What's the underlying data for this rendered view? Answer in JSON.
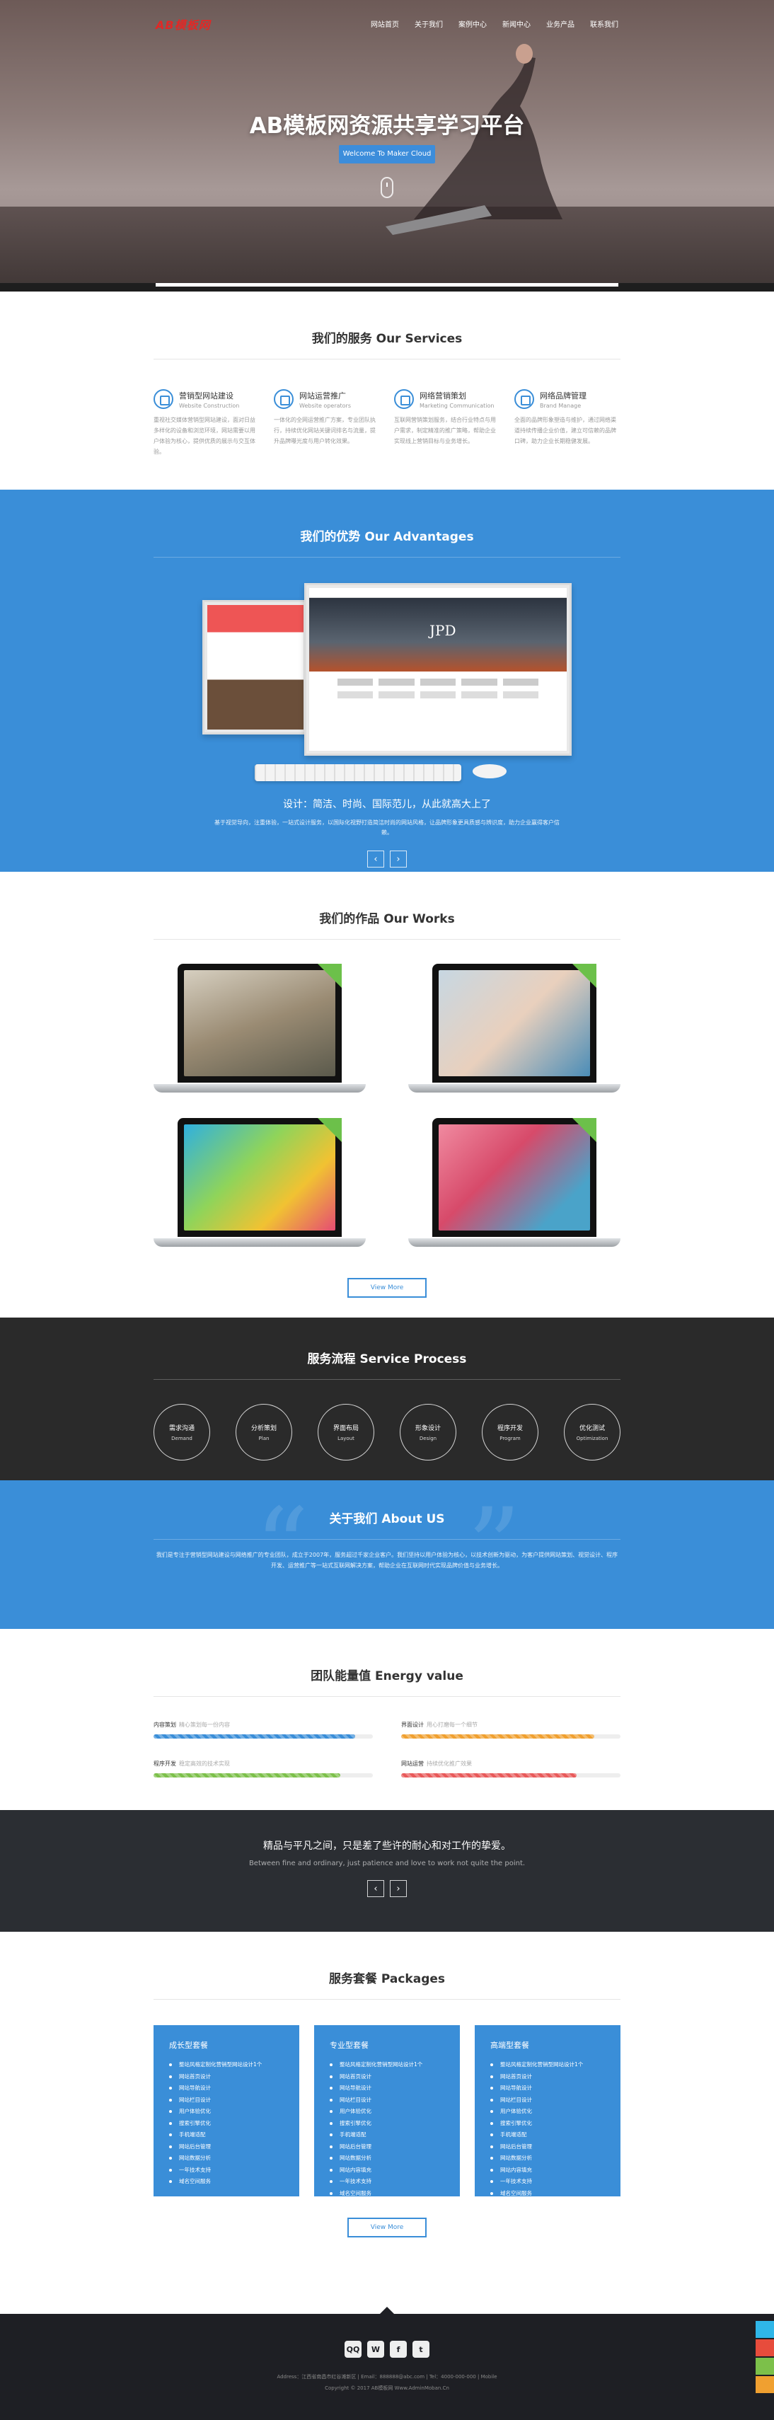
{
  "header": {
    "logo": "AB模板网",
    "nav": [
      "网站首页",
      "关于我们",
      "案例中心",
      "新闻中心",
      "业务产品",
      "联系我们"
    ]
  },
  "hero": {
    "title": "AB模板网资源共享学习平台",
    "button": "Welcome To Maker Cloud"
  },
  "services": {
    "title": "我们的服务 Our Services",
    "items": [
      {
        "icon": "gear-icon",
        "title": "营销型网站建设",
        "subtitle": "Website Construction",
        "desc": "重视社交媒体营销型网站建设，面对日益多样化的设备和浏览环境，网站需要以用户体验为核心，提供优质的展示与交互体验。"
      },
      {
        "icon": "chart-icon",
        "title": "网站运营推广",
        "subtitle": "Website operators",
        "desc": "一体化的全网运营推广方案，专业团队执行，持续优化网站关键词排名与流量，提升品牌曝光度与用户转化效果。"
      },
      {
        "icon": "compass-icon",
        "title": "网络营销策划",
        "subtitle": "Marketing Communication",
        "desc": "互联网营销策划服务，结合行业特点与用户需求，制定精准的推广策略，帮助企业实现线上营销目标与业务增长。"
      },
      {
        "icon": "refresh-icon",
        "title": "网络品牌管理",
        "subtitle": "Brand Manage",
        "desc": "全面的品牌形象塑造与维护，通过网络渠道持续传播企业价值，建立可信赖的品牌口碑，助力企业长期稳健发展。"
      }
    ]
  },
  "advantages": {
    "title": "我们的优势 Our Advantages",
    "heading": "设计：简洁、时尚、国际范儿，从此就高大上了",
    "desc": "基于视觉导向，注重体验，一站式设计服务，以国际化视野打造简洁时尚的网站风格，让品牌形象更具质感与辨识度，助力企业赢得客户信赖。",
    "screen_brand": "JPD"
  },
  "works": {
    "title": "我们的作品 Our Works",
    "more": "View More",
    "items": [
      {
        "name": "work-ring-dancers"
      },
      {
        "name": "work-dental"
      },
      {
        "name": "work-colorful-app"
      },
      {
        "name": "work-fitness"
      }
    ]
  },
  "process": {
    "title": "服务流程 Service Process",
    "steps": [
      {
        "cn": "需求沟通",
        "en": "Demand"
      },
      {
        "cn": "分析策划",
        "en": "Plan"
      },
      {
        "cn": "界面布局",
        "en": "Layout"
      },
      {
        "cn": "形象设计",
        "en": "Design"
      },
      {
        "cn": "程序开发",
        "en": "Program"
      },
      {
        "cn": "优化测试",
        "en": "Optimization"
      }
    ]
  },
  "about": {
    "title": "关于我们 About US",
    "text": "我们是专注于营销型网站建设与网络推广的专业团队，成立于2007年，服务超过千家企业客户。我们坚持以用户体验为核心，以技术创新为驱动，为客户提供网站策划、视觉设计、程序开发、运营推广等一站式互联网解决方案，帮助企业在互联网时代实现品牌价值与业务增长。"
  },
  "energy": {
    "title": "团队能量值 Energy value",
    "items": [
      {
        "label": "内容策划",
        "note": "精心策划每一份内容",
        "pct": 92,
        "color": "#3a8ed8"
      },
      {
        "label": "界面设计",
        "note": "用心打磨每一个细节",
        "pct": 88,
        "color": "#f0a030"
      },
      {
        "label": "程序开发",
        "note": "稳定高效的技术实现",
        "pct": 85,
        "color": "#7cc04a"
      },
      {
        "label": "网站运营",
        "note": "持续优化推广效果",
        "pct": 80,
        "color": "#e85a5a"
      }
    ]
  },
  "band": {
    "title": "精品与平凡之间，只是差了些许的耐心和对工作的挚爱。",
    "subtitle": "Between fine and ordinary, just patience and love to work not quite the point."
  },
  "packages": {
    "title": "服务套餐 Packages",
    "more": "View More",
    "items": [
      {
        "name": "成长型套餐",
        "features": [
          "整站风格定制化营销型网站设计1个",
          "网站首页设计",
          "网站导航设计",
          "网站栏目设计",
          "用户体验优化",
          "搜索引擎优化",
          "手机端适配",
          "网站后台管理",
          "网站数据分析",
          "一年技术支持",
          "域名空间服务"
        ]
      },
      {
        "name": "专业型套餐",
        "features": [
          "整站风格定制化营销型网站设计1个",
          "网站首页设计",
          "网站导航设计",
          "网站栏目设计",
          "用户体验优化",
          "搜索引擎优化",
          "手机端适配",
          "网站后台管理",
          "网站数据分析",
          "网站内容填充",
          "一年技术支持",
          "域名空间服务"
        ]
      },
      {
        "name": "高端型套餐",
        "features": [
          "整站风格定制化营销型网站设计1个",
          "网站首页设计",
          "网站导航设计",
          "网站栏目设计",
          "用户体验优化",
          "搜索引擎优化",
          "手机端适配",
          "网站后台管理",
          "网站数据分析",
          "网站内容填充",
          "一年技术支持",
          "域名空间服务"
        ]
      }
    ]
  },
  "footer": {
    "social": [
      "QQ",
      "W",
      "f",
      "t"
    ],
    "line1": "Address：江西省南昌市红谷滩新区 | Email：888888@abc.com | Tel：4000-000-000 | Mobile",
    "line2": "Copyright © 2017 AB模板网 Www.AdminMoban.Cn"
  }
}
